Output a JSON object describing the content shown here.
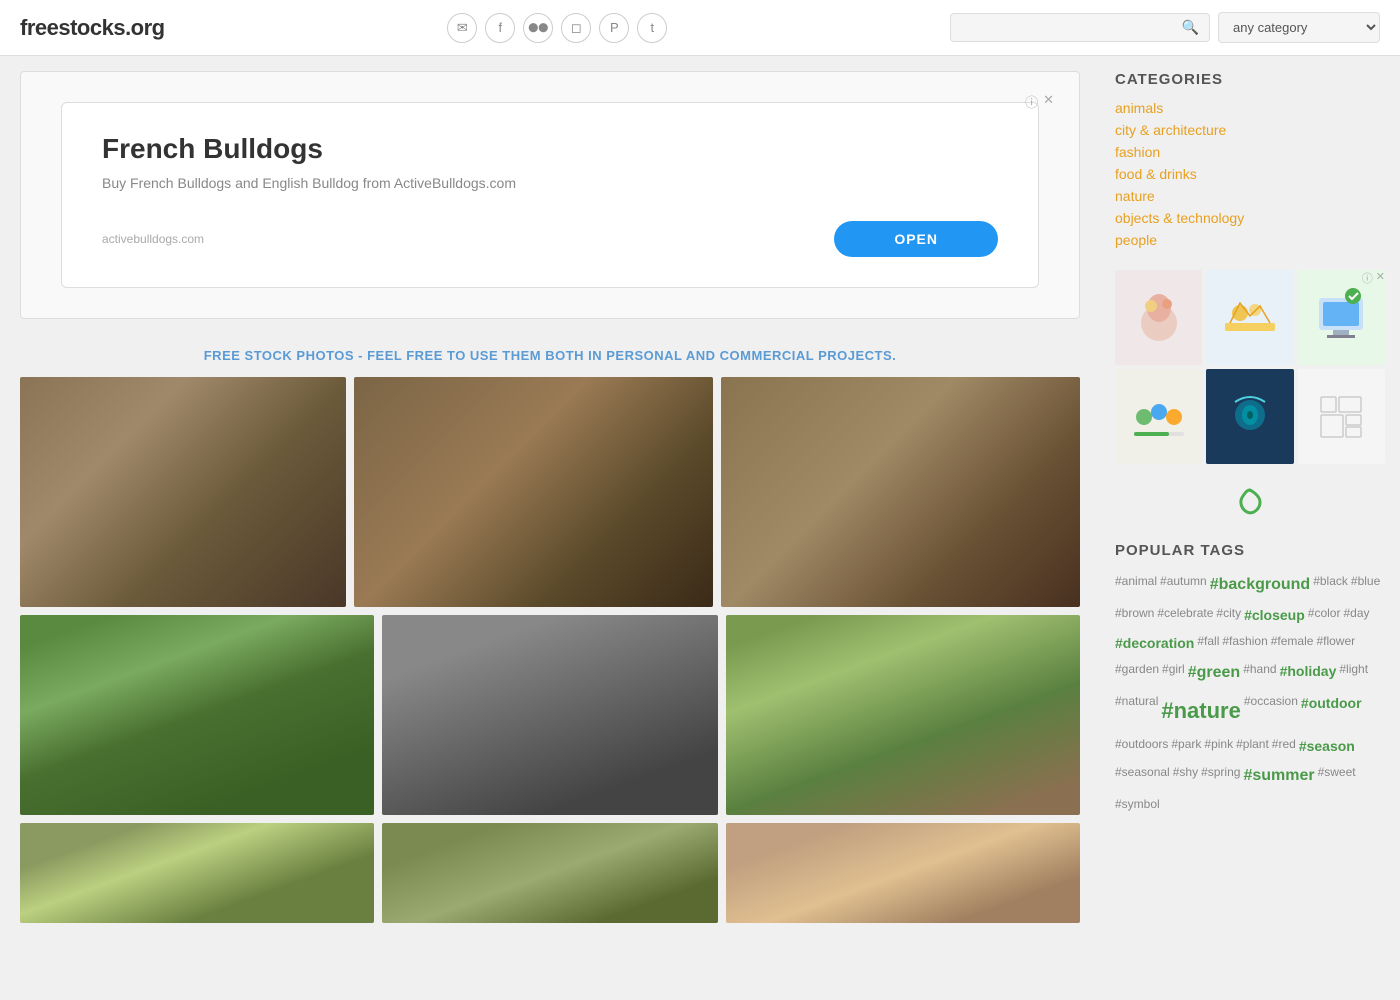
{
  "header": {
    "logo": "freestocks.org",
    "search_placeholder": "",
    "category_default": "any category",
    "category_options": [
      "any category",
      "animals",
      "city & architecture",
      "fashion",
      "food & drinks",
      "nature",
      "objects & technology",
      "people"
    ]
  },
  "social_icons": [
    {
      "name": "email",
      "symbol": "✉"
    },
    {
      "name": "facebook",
      "symbol": "f"
    },
    {
      "name": "flickr",
      "symbol": "●●"
    },
    {
      "name": "instagram",
      "symbol": "◻"
    },
    {
      "name": "pinterest",
      "symbol": "p"
    },
    {
      "name": "twitter",
      "symbol": "t"
    }
  ],
  "ad": {
    "title": "French Bulldogs",
    "subtitle": "Buy French Bulldogs and English Bulldog from ActiveBulldogs.com",
    "source": "activebulldogs.com",
    "open_label": "OPEN",
    "info_icon": "ⓘ",
    "close_icon": "✕"
  },
  "tagline": "FREE STOCK PHOTOS - FEEL FREE TO USE THEM BOTH IN PERSONAL AND COMMERCIAL PROJECTS.",
  "sidebar": {
    "categories_title": "CATEGORIES",
    "categories": [
      "animals",
      "city & architecture",
      "fashion",
      "food & drinks",
      "nature",
      "objects & technology",
      "people"
    ],
    "popular_tags_title": "POPULAR TAGS",
    "tags": [
      {
        "text": "#animal",
        "size": "small"
      },
      {
        "text": "#autumn",
        "size": "small"
      },
      {
        "text": "#background",
        "size": "big"
      },
      {
        "text": "#black",
        "size": "small"
      },
      {
        "text": "#blue",
        "size": "small"
      },
      {
        "text": "#brown",
        "size": "small"
      },
      {
        "text": "#celebrate",
        "size": "small"
      },
      {
        "text": "#city",
        "size": "small"
      },
      {
        "text": "#closeup",
        "size": "medium"
      },
      {
        "text": "#color",
        "size": "small"
      },
      {
        "text": "#day",
        "size": "small"
      },
      {
        "text": "#decoration",
        "size": "medium"
      },
      {
        "text": "#fall",
        "size": "small"
      },
      {
        "text": "#fashion",
        "size": "small"
      },
      {
        "text": "#female",
        "size": "small"
      },
      {
        "text": "#flower",
        "size": "small"
      },
      {
        "text": "#garden",
        "size": "small"
      },
      {
        "text": "#girl",
        "size": "small"
      },
      {
        "text": "#green",
        "size": "big"
      },
      {
        "text": "#hand",
        "size": "small"
      },
      {
        "text": "#holiday",
        "size": "medium"
      },
      {
        "text": "#light",
        "size": "small"
      },
      {
        "text": "#natural",
        "size": "small"
      },
      {
        "text": "#nature",
        "size": "nature-big"
      },
      {
        "text": "#occasion",
        "size": "small"
      },
      {
        "text": "#outdoor",
        "size": "medium"
      },
      {
        "text": "#outdoors",
        "size": "small"
      },
      {
        "text": "#park",
        "size": "small"
      },
      {
        "text": "#pink",
        "size": "small"
      },
      {
        "text": "#plant",
        "size": "small"
      },
      {
        "text": "#red",
        "size": "small"
      },
      {
        "text": "#season",
        "size": "medium"
      },
      {
        "text": "#seasonal",
        "size": "small"
      },
      {
        "text": "#shy",
        "size": "small"
      },
      {
        "text": "#spring",
        "size": "small"
      },
      {
        "text": "#summer",
        "size": "big"
      },
      {
        "text": "#sweet",
        "size": "small"
      },
      {
        "text": "#symbol",
        "size": "small"
      }
    ],
    "ad_info": "ⓘ",
    "ad_close": "✕"
  }
}
